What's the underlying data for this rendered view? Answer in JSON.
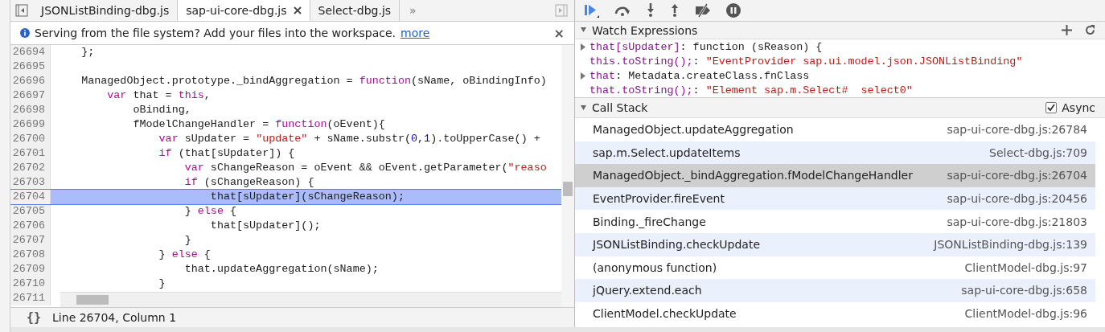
{
  "tabs": [
    {
      "label": "JSONListBinding-dbg.js",
      "selected": false,
      "closable": false
    },
    {
      "label": "sap-ui-core-dbg.js",
      "selected": true,
      "closable": true
    },
    {
      "label": "Select-dbg.js",
      "selected": false,
      "closable": false
    }
  ],
  "tabs_overflow": "»",
  "infobar": {
    "message": "Serving from the file system? Add your files into the workspace.",
    "link": "more",
    "close": "×"
  },
  "code": [
    {
      "number": "26694",
      "highlighted": false,
      "tokens": [
        {
          "kind": "plain",
          "text": "    };"
        }
      ]
    },
    {
      "number": "26695",
      "highlighted": false
    },
    {
      "number": "26696",
      "highlighted": false,
      "tokens": [
        {
          "kind": "plain",
          "text": "    ManagedObject.prototype._bindAggregation = "
        },
        {
          "kind": "keyword",
          "text": "function"
        },
        {
          "kind": "plain",
          "text": "(sName, oBindingInfo)"
        }
      ]
    },
    {
      "number": "26697",
      "highlighted": false,
      "tokens": [
        {
          "kind": "keyword",
          "text": "        var"
        },
        {
          "kind": "plain",
          "text": " that = "
        },
        {
          "kind": "keyword",
          "text": "this"
        },
        {
          "kind": "plain",
          "text": ","
        }
      ]
    },
    {
      "number": "26698",
      "highlighted": false,
      "tokens": [
        {
          "kind": "plain",
          "text": "            oBinding,"
        }
      ]
    },
    {
      "number": "26699",
      "highlighted": false,
      "tokens": [
        {
          "kind": "plain",
          "text": "            fModelChangeHandler = "
        },
        {
          "kind": "keyword",
          "text": "function"
        },
        {
          "kind": "plain",
          "text": "(oEvent){"
        }
      ]
    },
    {
      "number": "26700",
      "highlighted": false,
      "tokens": [
        {
          "kind": "keyword",
          "text": "                var"
        },
        {
          "kind": "plain",
          "text": " sUpdater = "
        },
        {
          "kind": "string",
          "text": "\"update\""
        },
        {
          "kind": "plain",
          "text": " + sName.substr("
        },
        {
          "kind": "number",
          "text": "0"
        },
        {
          "kind": "plain",
          "text": ","
        },
        {
          "kind": "number",
          "text": "1"
        },
        {
          "kind": "plain",
          "text": ").toUpperCase() +"
        }
      ]
    },
    {
      "number": "26701",
      "highlighted": false,
      "tokens": [
        {
          "kind": "keyword",
          "text": "                if"
        },
        {
          "kind": "plain",
          "text": " (that[sUpdater]) {"
        }
      ]
    },
    {
      "number": "26702",
      "highlighted": false,
      "tokens": [
        {
          "kind": "keyword",
          "text": "                    var"
        },
        {
          "kind": "plain",
          "text": " sChangeReason = oEvent && oEvent.getParameter("
        },
        {
          "kind": "string",
          "text": "\"reaso"
        }
      ]
    },
    {
      "number": "26703",
      "highlighted": false,
      "tokens": [
        {
          "kind": "keyword",
          "text": "                    if"
        },
        {
          "kind": "plain",
          "text": " (sChangeReason) {"
        }
      ]
    },
    {
      "number": "26704",
      "highlighted": true,
      "tokens": [
        {
          "kind": "plain",
          "text": "                        that[sUpdater](sChangeReason);"
        }
      ]
    },
    {
      "number": "26705",
      "highlighted": false,
      "tokens": [
        {
          "kind": "plain",
          "text": "                    } "
        },
        {
          "kind": "keyword",
          "text": "else"
        },
        {
          "kind": "plain",
          "text": " {"
        }
      ]
    },
    {
      "number": "26706",
      "highlighted": false,
      "tokens": [
        {
          "kind": "plain",
          "text": "                        that[sUpdater]();"
        }
      ]
    },
    {
      "number": "26707",
      "highlighted": false,
      "tokens": [
        {
          "kind": "plain",
          "text": "                    }"
        }
      ]
    },
    {
      "number": "26708",
      "highlighted": false,
      "tokens": [
        {
          "kind": "plain",
          "text": "                } "
        },
        {
          "kind": "keyword",
          "text": "else"
        },
        {
          "kind": "plain",
          "text": " {"
        }
      ]
    },
    {
      "number": "26709",
      "highlighted": false,
      "tokens": [
        {
          "kind": "plain",
          "text": "                    that.updateAggregation(sName);"
        }
      ]
    },
    {
      "number": "26710",
      "highlighted": false,
      "tokens": [
        {
          "kind": "plain",
          "text": "                }"
        }
      ]
    },
    {
      "number": "26711",
      "highlighted": false
    }
  ],
  "status_bar": {
    "format_icon": "{}",
    "position": "Line 26704, Column 1"
  },
  "watch": {
    "title": "Watch Expressions",
    "items": [
      {
        "kind": "expandable",
        "name": "that[sUpdater]",
        "separator": ":",
        "value": "function (sReason) {"
      },
      {
        "kind": "leaf",
        "name": "this.toString();",
        "separator": ":",
        "value": "\"EventProvider sap.ui.model.json.JSONListBinding\""
      },
      {
        "kind": "expandable",
        "name": "that",
        "separator": ":",
        "value": "Metadata.createClass.fnClass"
      },
      {
        "kind": "leaf",
        "name": "that.toString();",
        "separator": ":",
        "value": "\"Element sap.m.Select#  select0\""
      }
    ]
  },
  "call_stack": {
    "title": "Call Stack",
    "async_label": "Async",
    "async_checked": true,
    "frames": [
      {
        "function": "ManagedObject.updateAggregation",
        "location": "sap-ui-core-dbg.js:26784",
        "selected": false
      },
      {
        "function": "sap.m.Select.updateItems",
        "location": "Select-dbg.js:709",
        "selected": false
      },
      {
        "function": "ManagedObject._bindAggregation.fModelChangeHandler",
        "location": "sap-ui-core-dbg.js:26704",
        "selected": true
      },
      {
        "function": "EventProvider.fireEvent",
        "location": "sap-ui-core-dbg.js:20456",
        "selected": false
      },
      {
        "function": "Binding._fireChange",
        "location": "sap-ui-core-dbg.js:21803",
        "selected": false
      },
      {
        "function": "JSONListBinding.checkUpdate",
        "location": "JSONListBinding-dbg.js:139",
        "selected": false
      },
      {
        "function": "(anonymous function)",
        "location": "ClientModel-dbg.js:97",
        "selected": false
      },
      {
        "function": "jQuery.extend.each",
        "location": "sap-ui-core-dbg.js:658",
        "selected": false
      },
      {
        "function": "ClientModel.checkUpdate",
        "location": "ClientModel-dbg.js:96",
        "selected": false
      }
    ]
  }
}
